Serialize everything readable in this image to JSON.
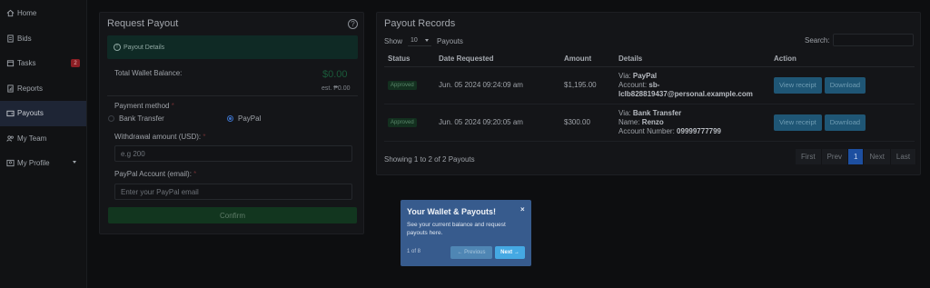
{
  "sidebar": {
    "items": [
      {
        "label": "Home",
        "icon": "home-icon"
      },
      {
        "label": "Bids",
        "icon": "bids-icon"
      },
      {
        "label": "Tasks",
        "icon": "calendar-icon",
        "badge": "2"
      },
      {
        "label": "Reports",
        "icon": "reports-icon"
      },
      {
        "label": "Payouts",
        "icon": "wallet-icon",
        "active": true
      },
      {
        "label": "My Team",
        "icon": "team-icon"
      },
      {
        "label": "My Profile",
        "icon": "profile-icon"
      }
    ]
  },
  "request": {
    "title": "Request Payout",
    "details_label": "Payout Details",
    "balance_label": "Total Wallet Balance:",
    "balance_value": "$0.00",
    "balance_est": "est. ₱0.00",
    "method_label": "Payment method",
    "method_options": [
      "Bank Transfer",
      "PayPal"
    ],
    "method_selected": "PayPal",
    "amount_label": "Withdrawal amount (USD):",
    "amount_placeholder": "e.g 200",
    "account_label": "PayPal Account (email):",
    "account_placeholder": "Enter your PayPal email",
    "confirm_label": "Confirm",
    "required_mark": "*"
  },
  "records": {
    "title": "Payout Records",
    "show_label": "Show",
    "show_value": "10",
    "show_suffix": "Payouts",
    "search_label": "Search:",
    "columns": [
      "Status",
      "Date Requested",
      "Amount",
      "Details",
      "Action"
    ],
    "rows": [
      {
        "status": "Approved",
        "date": "Jun. 05 2024 09:24:09 am",
        "amount": "$1,195.00",
        "d1_key": "Via:",
        "d1_val": "PayPal",
        "d2_key": "Account:",
        "d2_val": "sb-lclb828819437@personal.example.com",
        "d3_key": "",
        "d3_val": ""
      },
      {
        "status": "Approved",
        "date": "Jun. 05 2024 09:20:05 am",
        "amount": "$300.00",
        "d1_key": "Via:",
        "d1_val": "Bank Transfer",
        "d2_key": "Name:",
        "d2_val": "Renzo",
        "d3_key": "Account Number:",
        "d3_val": "09999777799"
      }
    ],
    "view_label": "View receipt",
    "download_label": "Download",
    "showing_text": "Showing 1 to 2 of 2 Payouts",
    "pager": [
      "First",
      "Prev",
      "1",
      "Next",
      "Last"
    ],
    "current_page": "1"
  },
  "tour": {
    "title": "Your Wallet & Payouts!",
    "close": "×",
    "text": "See your current balance and request payouts here.",
    "step": "1 of 8",
    "prev_label": "← Previous",
    "next_label": "Next →"
  },
  "colors": {
    "accent": "#1d4fa0",
    "tour_bg": "#375b8d",
    "approved": "#13301f",
    "confirm": "#12361f"
  }
}
